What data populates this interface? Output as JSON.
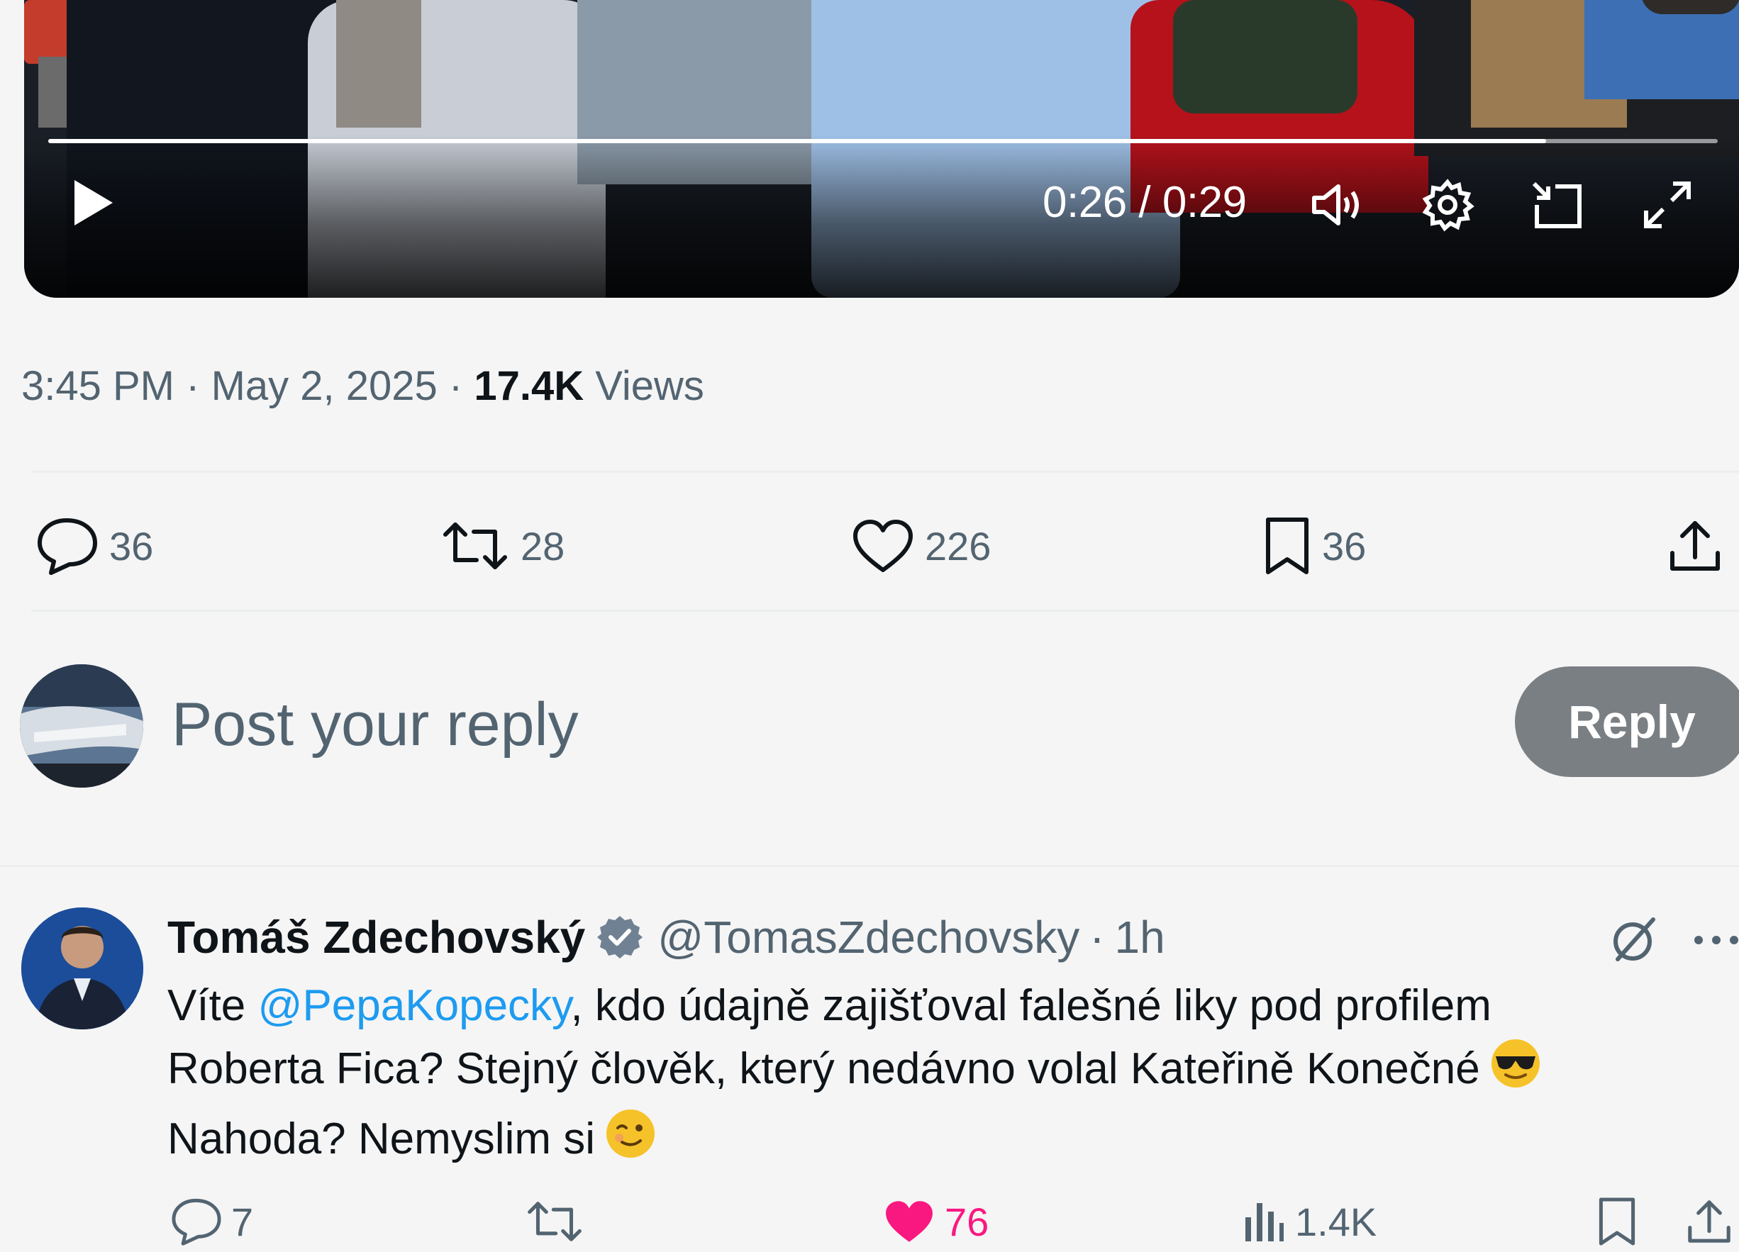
{
  "video": {
    "current_time": "0:26",
    "separator": "/",
    "duration": "0:29",
    "progress_fraction": 0.897
  },
  "post_meta": {
    "time": "3:45 PM",
    "dot1": "·",
    "date": "May 2, 2025",
    "dot2": "·",
    "views_count": "17.4K",
    "views_label": "Views"
  },
  "actions": {
    "replies": "36",
    "reposts": "28",
    "likes": "226",
    "bookmarks": "36"
  },
  "composer": {
    "placeholder": "Post your reply",
    "reply_button": "Reply"
  },
  "reply": {
    "author_name": "Tomáš Zdechovský",
    "handle": "@TomasZdechovsky",
    "dot": "·",
    "time": "1h",
    "text_before_mention": "Víte ",
    "mention": "@PepaKopecky",
    "text_line1_rest": ", kdo údajně zajišťoval falešné liky pod profilem",
    "text_line2": "Roberta Fica? Stejný člověk, který nedávno volal Kateřině Konečné",
    "text_line3": "Nahoda? Nemyslim si",
    "replies": "7",
    "reposts": "",
    "likes": "76",
    "views": "1.4K"
  },
  "colors": {
    "accent": "#1d9bf0",
    "like_pink": "#f91880",
    "muted": "#536471",
    "reply_button_bg": "#7a7f84",
    "background": "#f5f5f5"
  },
  "icons": {
    "play": "play-icon",
    "volume": "volume-icon",
    "settings": "gear-icon",
    "pip": "picture-in-picture-icon",
    "fullscreen": "fullscreen-icon",
    "reply": "reply-bubble-icon",
    "repost": "repost-icon",
    "like": "heart-icon",
    "bookmark": "bookmark-icon",
    "share": "share-icon",
    "verified": "verified-badge-icon",
    "grok": "grok-icon",
    "more": "more-dots-icon",
    "views": "analytics-icon"
  }
}
